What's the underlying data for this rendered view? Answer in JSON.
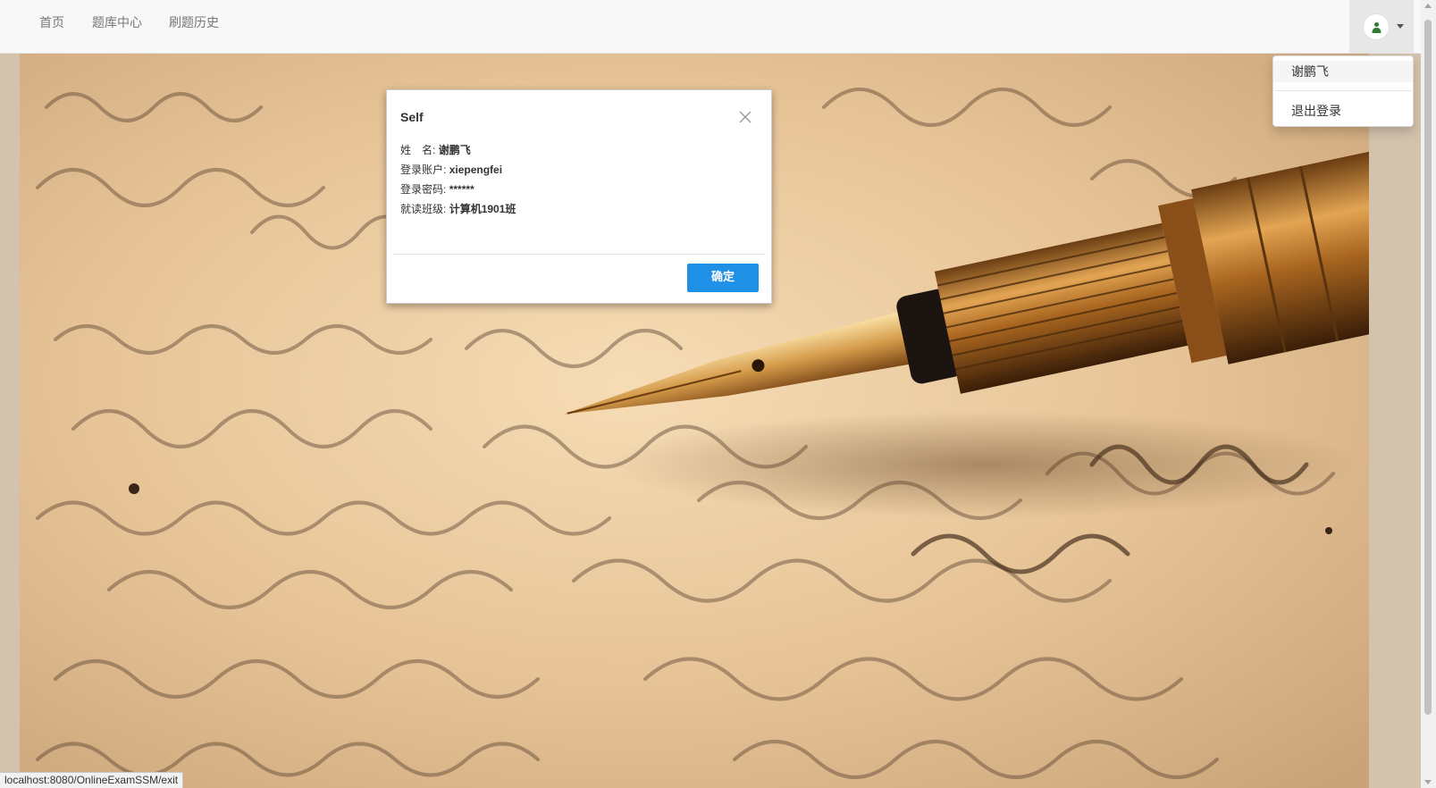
{
  "navbar": {
    "links": [
      {
        "label": "首页"
      },
      {
        "label": "题库中心"
      },
      {
        "label": "刷题历史"
      }
    ]
  },
  "user_menu": {
    "items": [
      {
        "label": "谢鹏飞",
        "active": true
      },
      {
        "label": "退出登录",
        "active": false
      }
    ],
    "avatar_icon": "user-avatar-icon",
    "caret_icon": "caret-down-icon"
  },
  "modal": {
    "title": "Self",
    "fields": [
      {
        "label": "姓　名:",
        "value": "谢鹏飞"
      },
      {
        "label": "登录账户:",
        "value": "xiepengfei"
      },
      {
        "label": "登录密码:",
        "value": "******"
      },
      {
        "label": "就读班级:",
        "value": "计算机1901班"
      }
    ],
    "confirm_label": "确定",
    "close_icon": "close-icon"
  },
  "status_bar": {
    "url": "localhost:8080/OnlineExamSSM/exit"
  },
  "colors": {
    "primary": "#1e90e6",
    "navbar_bg": "#f8f8f8",
    "nav_text": "#777777"
  }
}
